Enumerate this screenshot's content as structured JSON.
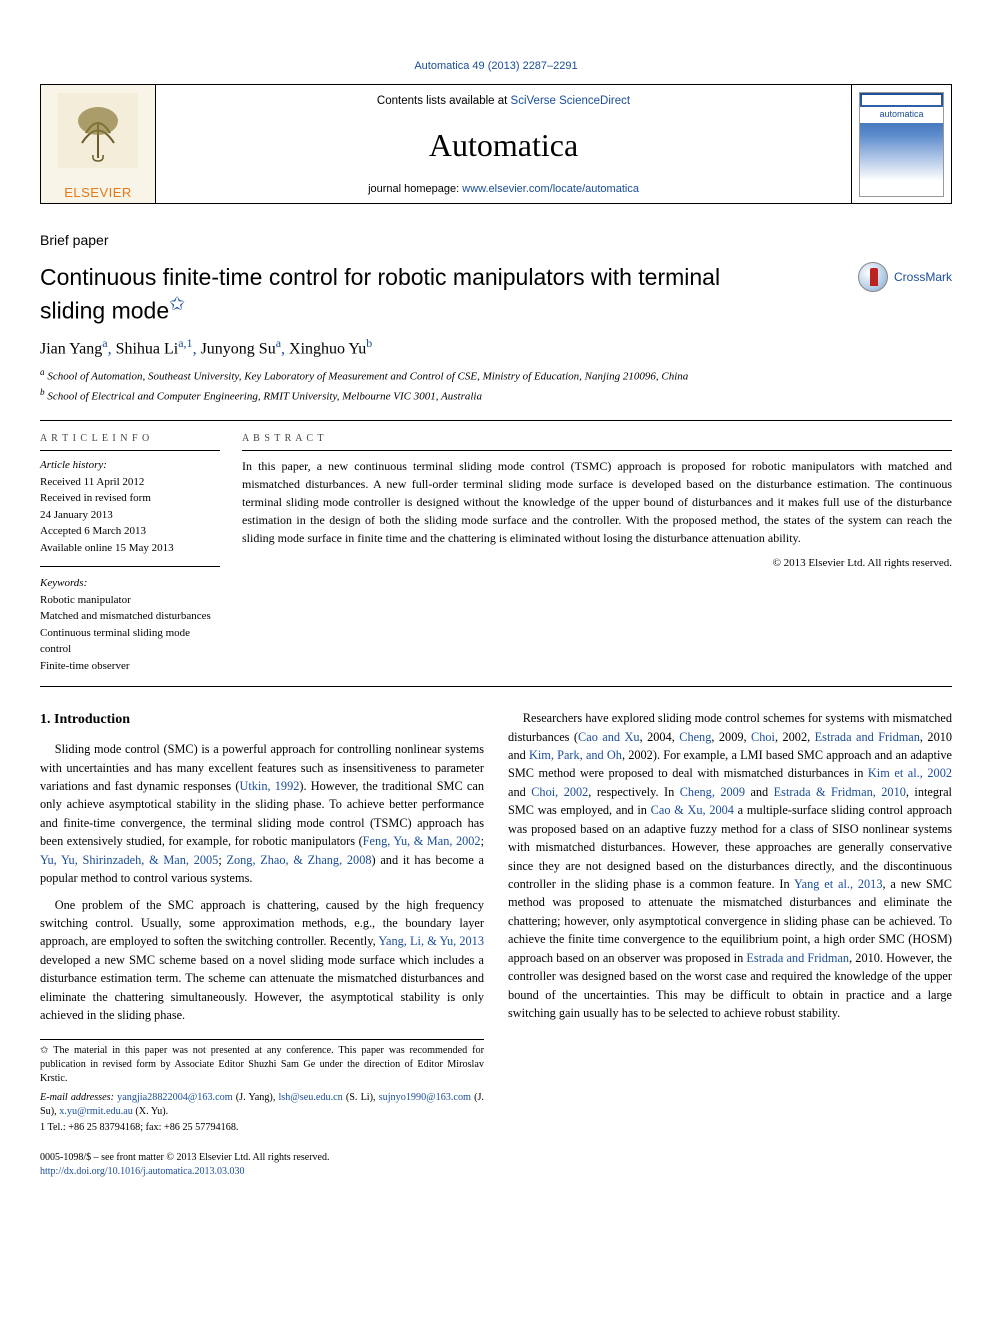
{
  "running_head": "Automatica 49 (2013) 2287–2291",
  "masthead": {
    "contents_prefix": "Contents lists available at ",
    "contents_link": "SciVerse ScienceDirect",
    "journal": "Automatica",
    "homepage_prefix": "journal homepage: ",
    "homepage_link": "www.elsevier.com/locate/automatica",
    "elsevier": "ELSEVIER",
    "cover_label": "automatica"
  },
  "crossmark_text": "CrossMark",
  "section_heading": "Brief paper",
  "title_line1": "Continuous finite-time control for robotic manipulators with terminal",
  "title_line2": "sliding mode",
  "star": "✩",
  "authors": {
    "a1": "Jian Yang",
    "a1_sup": "a",
    "a2": "Shihua Li",
    "a2_sup": "a,1",
    "a3": "Junyong Su",
    "a3_sup": "a",
    "a4": "Xinghuo Yu",
    "a4_sup": "b"
  },
  "affils": {
    "a": "School of Automation, Southeast University, Key Laboratory of Measurement and Control of CSE, Ministry of Education, Nanjing 210096, China",
    "b": "School of Electrical and Computer Engineering, RMIT University, Melbourne VIC 3001, Australia"
  },
  "history": {
    "header": "A R T I C L E   I N F O",
    "l1": "Article history:",
    "l2": "Received 11 April 2012",
    "l3": "Received in revised form",
    "l4": "24 January 2013",
    "l5": "Accepted 6 March 2013",
    "l6": "Available online 15 May 2013",
    "kw_head": "Keywords:",
    "kw1": "Robotic manipulator",
    "kw2": "Matched and mismatched disturbances",
    "kw3": "Continuous terminal sliding mode control",
    "kw4": "Finite-time observer"
  },
  "abstract": {
    "header": "A B S T R A C T",
    "text": "In this paper, a new continuous terminal sliding mode control (TSMC) approach is proposed for robotic manipulators with matched and mismatched disturbances. A new full-order terminal sliding mode surface is developed based on the disturbance estimation. The continuous terminal sliding mode controller is designed without the knowledge of the upper bound of disturbances and it makes full use of the disturbance estimation in the design of both the sliding mode surface and the controller. With the proposed method, the states of the system can reach the sliding mode surface in finite time and the chattering is eliminated without losing the disturbance attenuation ability.",
    "copyright": "© 2013 Elsevier Ltd. All rights reserved."
  },
  "col_left": {
    "h2": "1. Introduction",
    "p1a": "Sliding mode control (SMC) is a powerful approach for controlling nonlinear systems with uncertainties and has many excellent features such as insensitiveness to parameter variations and fast dynamic responses (",
    "c1": "Utkin, 1992",
    "p1b": "). However, the traditional SMC can only achieve asymptotical stability in the sliding phase. To achieve better performance and finite-time convergence, the terminal sliding mode control (TSMC) approach has been extensively studied, for example, for robotic manipulators (",
    "c2": "Feng, Yu, & Man, 2002",
    "c2s": "; ",
    "c3": "Yu, Yu, Shirinzadeh, & Man, 2005",
    "c3s": "; ",
    "c4": "Zong, Zhao, & Zhang, 2008",
    "p1c": ") and it has become a popular method to control various systems.",
    "p2a": "One problem of the SMC approach is chattering, caused by the high frequency switching control. Usually, some approximation methods, e.g., the boundary layer approach, are employed to soften the switching controller. Recently, ",
    "c5": "Yang, Li, & Yu, 2013",
    "p2b": " developed a new SMC scheme based on a novel sliding mode surface which includes a disturbance estimation term. The scheme can attenuate the mismatched disturbances and eliminate the chattering simultaneously. However, the asymptotical stability is only achieved in the sliding phase."
  },
  "col_right": {
    "p1a": "Researchers have explored sliding mode control schemes for systems with mismatched disturbances (",
    "c6": "Cao and Xu",
    "c6s": ", 2004, ",
    "c7": "Cheng",
    "c7s": ", 2009, ",
    "c8": "Choi",
    "c8s": ", 2002, ",
    "c9": "Estrada and Fridman",
    "c9s": ", 2010 and ",
    "c10": "Kim, Park, and Oh",
    "c10s": ", 2002",
    "p1b": "). For example, a LMI based SMC approach and an adaptive SMC method were proposed to deal with mismatched disturbances in ",
    "c11": "Kim et al., 2002",
    "p1c": " and ",
    "c12": "Choi, 2002",
    "p1d": ", respectively. In ",
    "c13": "Cheng, 2009",
    "p1e": " and ",
    "c14": "Estrada & Fridman, 2010",
    "p1f": ", integral SMC was employed, and in ",
    "c15": "Cao & Xu, 2004",
    "p1g": " a multiple-surface sliding control approach was proposed based on an adaptive fuzzy method for a class of SISO nonlinear systems with mismatched disturbances. However, these approaches are generally conservative since they are not designed based on the disturbances directly, and the discontinuous controller in the sliding phase is a common feature. In ",
    "c16": "Yang et al., 2013",
    "p1h": ", a new SMC method was proposed to attenuate the mismatched disturbances and eliminate the chattering; however, only asymptotical convergence in sliding phase can be achieved. To achieve the finite time convergence to the equilibrium point, a high order SMC (HOSM) approach based on an observer was proposed in ",
    "c17": "Estrada and Fridman",
    "c17s": ", 2010",
    "p1i": ". However, the controller was designed based on the worst case and required the knowledge of the upper bound of the uncertainties. This may be difficult to obtain in practice and a large switching gain usually has to be selected to achieve robust stability."
  },
  "footnotes": {
    "star_note": "✩ The material in this paper was not presented at any conference. This paper was recommended for publication in revised form by Associate Editor Shuzhi Sam Ge under the direction of Editor Miroslav Krstic.",
    "emails_prefix": "E-mail addresses: ",
    "e1": "yangjia28822004@163.com",
    "e1n": " (J. Yang), ",
    "e2": "lsh@seu.edu.cn",
    "e2n": " (S. Li), ",
    "e3": "sujnyo1990@163.com",
    "e3n": " (J. Su), ",
    "e4": "x.yu@rmit.edu.au",
    "e4n": " (X. Yu).",
    "one": "1 Tel.: +86 25 83794168; fax: +86 25 57794168."
  },
  "foot_doi": {
    "line1": "0005-1098/$ – see front matter © 2013 Elsevier Ltd. All rights reserved.",
    "link": "http://dx.doi.org/10.1016/j.automatica.2013.03.030"
  }
}
